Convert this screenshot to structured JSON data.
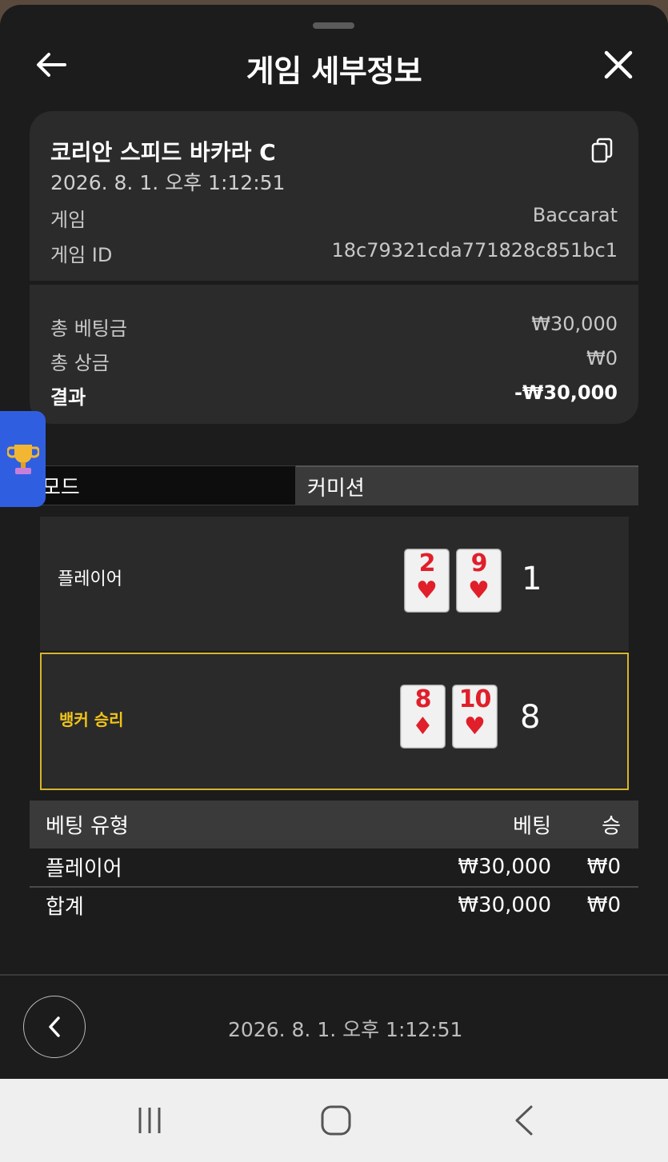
{
  "header": {
    "title": "게임 세부정보",
    "back_icon": "arrow-left-icon",
    "close_icon": "close-icon"
  },
  "summary": {
    "title": "코리안 스피드 바카라 C",
    "date": "2026. 8. 1. 오후 1:12:51",
    "game_label": "게임",
    "game_value": "Baccarat",
    "game_id_label": "게임 ID",
    "game_id_value": "18c79321cda771828c851bc1",
    "total_bet_label": "총 베팅금",
    "total_bet_value": "₩30,000",
    "total_win_label": "총 상금",
    "total_win_value": "₩0",
    "result_label": "결과",
    "result_value": "-₩30,000"
  },
  "tabs": {
    "mode": "모드",
    "commission": "커미션"
  },
  "hands": {
    "player": {
      "label": "플레이어",
      "cards": [
        {
          "rank": "2",
          "suit": "♥"
        },
        {
          "rank": "9",
          "suit": "♥"
        }
      ],
      "score": "1"
    },
    "banker": {
      "label": "뱅커 승리",
      "cards": [
        {
          "rank": "8",
          "suit": "♦"
        },
        {
          "rank": "10",
          "suit": "♥"
        }
      ],
      "score": "8"
    }
  },
  "bets": {
    "headers": {
      "type": "베팅 유형",
      "bet": "베팅",
      "win": "승"
    },
    "rows": [
      {
        "type": "플레이어",
        "bet": "₩30,000",
        "win": "₩0"
      }
    ],
    "total": {
      "type": "합계",
      "bet": "₩30,000",
      "win": "₩0"
    }
  },
  "footer": {
    "date": "2026. 8. 1. 오후 1:12:51"
  },
  "colors": {
    "sheet_bg": "#1c1c1c",
    "card_bg": "#2b2b2b",
    "winner_border": "#d8b62a",
    "suit_red": "#e01f2a",
    "badge_blue": "#2f5fe0"
  }
}
